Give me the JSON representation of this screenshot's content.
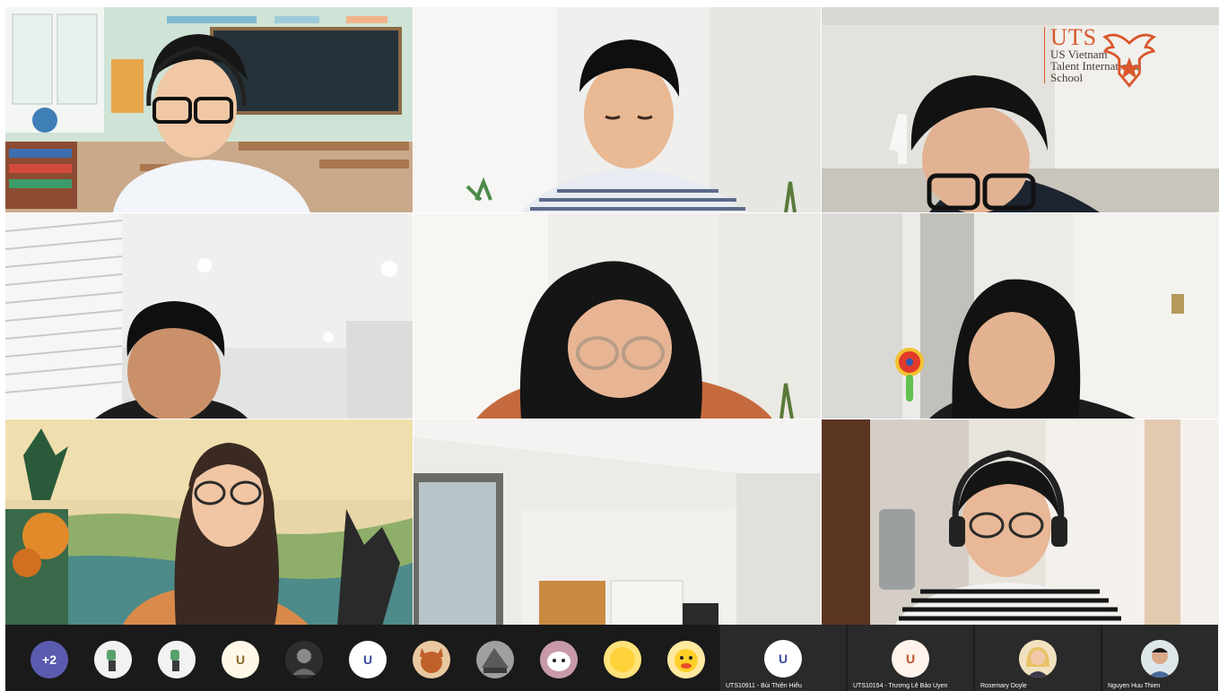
{
  "logo": {
    "title": "UTS",
    "lines": [
      "US Vietnam",
      "Talent International",
      "School"
    ],
    "accent": "#d9572b"
  },
  "tiles": [
    {
      "name": "video-tile-teacher-classroom"
    },
    {
      "name": "video-tile-boy-striped-shirt"
    },
    {
      "name": "video-tile-boy-glasses-room"
    },
    {
      "name": "video-tile-boy-blinds"
    },
    {
      "name": "video-tile-girl-glasses-desk"
    },
    {
      "name": "video-tile-girl-earphones"
    },
    {
      "name": "video-tile-girl-painting-background"
    },
    {
      "name": "video-tile-empty-room"
    },
    {
      "name": "video-tile-girl-headphones"
    }
  ],
  "overflow": {
    "label": "+2"
  },
  "chips": [
    {
      "kind": "avatar",
      "icon": "robot-sticker-icon"
    },
    {
      "kind": "avatar",
      "icon": "robot-sticker-icon"
    },
    {
      "kind": "initial",
      "label": "U"
    },
    {
      "kind": "avatar",
      "icon": "dark-photo-avatar-icon"
    },
    {
      "kind": "initial",
      "label": "U"
    },
    {
      "kind": "avatar",
      "icon": "cartoon-animal-avatar-icon"
    },
    {
      "kind": "avatar",
      "icon": "grayscale-photo-avatar-icon"
    },
    {
      "kind": "avatar",
      "icon": "white-cat-avatar-icon"
    },
    {
      "kind": "avatar",
      "icon": "yellow-ball-avatar-icon"
    },
    {
      "kind": "avatar",
      "icon": "yellow-duck-avatar-icon"
    }
  ],
  "participants": [
    {
      "name": "UTS10911 - Bùi Thiện Hiếu",
      "initial": "U"
    },
    {
      "name": "UTS10154 - Trương Lê Bảo  Uyen",
      "initial": "U"
    },
    {
      "name": "Rosemary Doyle",
      "initial": ""
    },
    {
      "name": "Nguyen Huu Thien",
      "initial": ""
    }
  ]
}
